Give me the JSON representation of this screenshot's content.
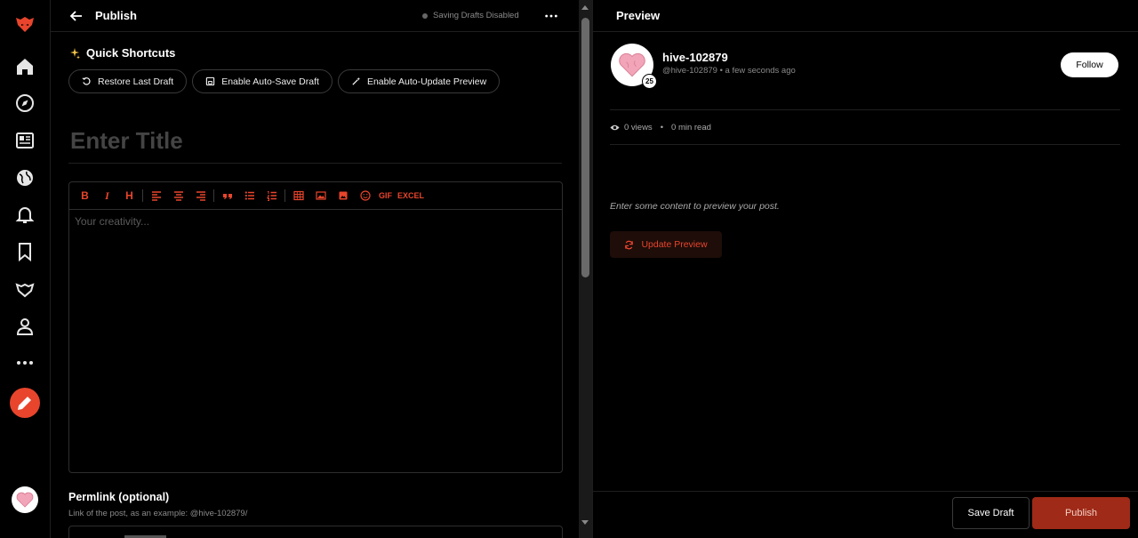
{
  "editor": {
    "header_title": "Publish",
    "draft_status": "Saving Drafts Disabled",
    "quick_shortcuts_label": "Quick Shortcuts",
    "shortcuts": [
      {
        "label": "Restore Last Draft",
        "icon": "undo-icon"
      },
      {
        "label": "Enable Auto-Save Draft",
        "icon": "save-icon"
      },
      {
        "label": "Enable Auto-Update Preview",
        "icon": "magic-wand-icon"
      }
    ],
    "title_placeholder": "Enter Title",
    "body_placeholder": "Your creativity...",
    "toolbar": {
      "bold": "B",
      "italic": "I",
      "heading": "H",
      "gif": "GIF",
      "excel": "EXCEL"
    },
    "permlink_label": "Permlink (optional)",
    "permlink_help": "Link of the post, as an example: @hive-102879/"
  },
  "preview": {
    "header_title": "Preview",
    "author_name": "hive-102879",
    "author_handle": "@hive-102879",
    "meta_separator": "•",
    "posted_time": "a few seconds ago",
    "reputation": "25",
    "follow_label": "Follow",
    "views": "0 views",
    "stats_separator": "•",
    "read_time": "0 min read",
    "empty_message": "Enter some content to preview your post.",
    "update_label": "Update Preview",
    "save_draft_label": "Save Draft",
    "publish_label": "Publish"
  },
  "colors": {
    "accent": "#e8452c",
    "background": "#000000",
    "publish_bg": "#9e2a17"
  }
}
